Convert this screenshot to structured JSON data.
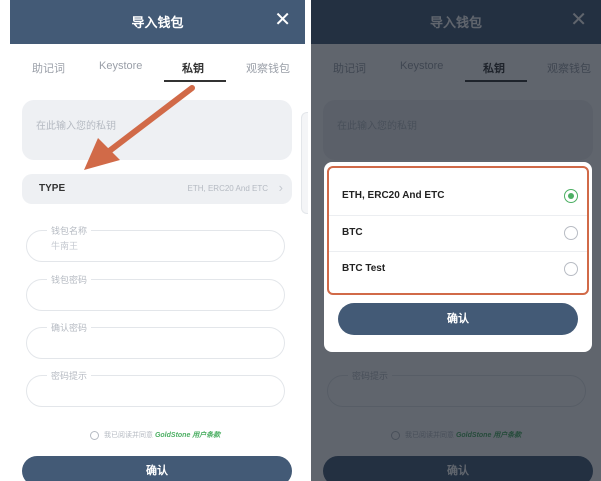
{
  "header": {
    "title": "导入钱包",
    "close_icon": "close-icon"
  },
  "tabs": [
    {
      "label": "助记词",
      "active": false
    },
    {
      "label": "Keystore",
      "active": false
    },
    {
      "label": "私钥",
      "active": true
    },
    {
      "label": "观察钱包",
      "active": false
    }
  ],
  "private_key": {
    "placeholder": "在此输入您的私钥"
  },
  "type_row": {
    "label": "TYPE",
    "value": "ETH, ERC20 And ETC"
  },
  "fields": {
    "wallet_name": {
      "label": "钱包名称",
      "value": "牛南王"
    },
    "password": {
      "label": "钱包密码"
    },
    "confirm_password": {
      "label": "确认密码"
    },
    "hint": {
      "label": "密码提示"
    }
  },
  "agreement": {
    "text": "我已阅读并同意",
    "link": "GoldStone 用户条款"
  },
  "confirm_label": "确认",
  "type_modal": {
    "options": [
      {
        "label": "ETH, ERC20 And ETC",
        "selected": true
      },
      {
        "label": "BTC",
        "selected": false
      },
      {
        "label": "BTC Test",
        "selected": false
      }
    ],
    "confirm_label": "确认"
  },
  "colors": {
    "header": "#435a76",
    "button": "#435a76",
    "selected_radio": "#4caf63",
    "highlight_arrow": "#d16a48",
    "link": "#4caf63"
  }
}
